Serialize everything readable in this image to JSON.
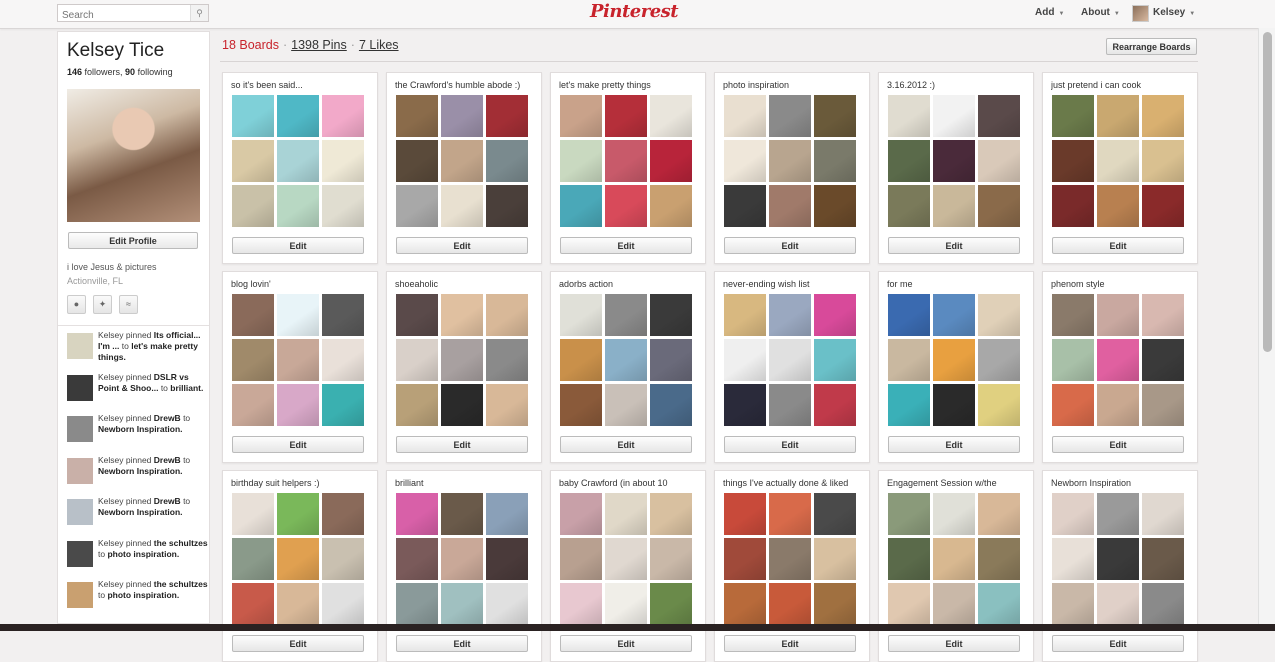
{
  "header": {
    "search_placeholder": "Search",
    "logo": "Pinterest",
    "nav": [
      {
        "label": "Add"
      },
      {
        "label": "About"
      },
      {
        "label": "Kelsey"
      }
    ]
  },
  "profile": {
    "name": "Kelsey Tice",
    "followers": "146",
    "followers_label": " followers, ",
    "following": "90",
    "following_label": " following",
    "edit_label": "Edit Profile",
    "bio": "i love Jesus & pictures",
    "location": "Actionville, FL"
  },
  "activity": [
    {
      "user": "Kelsey",
      "verb": " pinned ",
      "pin": "Its official... I'm ...",
      "to": " to ",
      "board": "let's make pretty things."
    },
    {
      "user": "Kelsey",
      "verb": " pinned ",
      "pin": "DSLR vs Point & Shoo...",
      "to": " to ",
      "board": "brilliant."
    },
    {
      "user": "Kelsey",
      "verb": " pinned ",
      "pin": "DrewB",
      "to": " to ",
      "board": "Newborn Inspiration."
    },
    {
      "user": "Kelsey",
      "verb": " pinned ",
      "pin": "DrewB",
      "to": " to ",
      "board": "Newborn Inspiration."
    },
    {
      "user": "Kelsey",
      "verb": " pinned ",
      "pin": "DrewB",
      "to": " to ",
      "board": "Newborn Inspiration."
    },
    {
      "user": "Kelsey",
      "verb": " pinned ",
      "pin": "the schultzes",
      "to": " to ",
      "board": "photo inspiration."
    },
    {
      "user": "Kelsey",
      "verb": " pinned ",
      "pin": "the schultzes",
      "to": " to ",
      "board": "photo inspiration."
    }
  ],
  "stats": {
    "boards": "18 Boards",
    "pins": "1398 Pins",
    "likes": "7 Likes",
    "separator": "·",
    "rearrange_label": "Rearrange Boards"
  },
  "edit_label": "Edit",
  "boards": [
    {
      "title": "so it's been said...",
      "colors": [
        "#7fd0d8",
        "#4fb8c6",
        "#f2a9c9",
        "#d9c9a5",
        "#a9d3d6",
        "#efe9d6",
        "#c9c1a8",
        "#b8d8c3",
        "#e0ddd0"
      ]
    },
    {
      "title": "the Crawford's humble abode :)",
      "colors": [
        "#8a6b4a",
        "#9a8fa8",
        "#a22e35",
        "#5a4a3a",
        "#c2a58a",
        "#7a8a8e",
        "#a8a8a8",
        "#e8e0d0",
        "#4a3f3a"
      ]
    },
    {
      "title": "let's make pretty things",
      "colors": [
        "#c9a28a",
        "#b52f3a",
        "#e9e5dc",
        "#c9d9c0",
        "#c85a6a",
        "#b8243a",
        "#4aa8b8",
        "#d84a5a",
        "#c9a070"
      ]
    },
    {
      "title": "photo inspiration",
      "colors": [
        "#e9dfd0",
        "#8a8a8a",
        "#6a5a3a",
        "#efe7da",
        "#b8a58f",
        "#7a7a6a",
        "#3a3a3a",
        "#a07a6a",
        "#6a4a2a"
      ]
    },
    {
      "title": "3.16.2012 :)",
      "colors": [
        "#e0dcd0",
        "#f2f2f2",
        "#5a4a4a",
        "#5a6a4a",
        "#4a2a3a",
        "#d9c9b9",
        "#7a7a5a",
        "#c9b89a",
        "#8a6a4a"
      ]
    },
    {
      "title": "just pretend i can cook",
      "colors": [
        "#6a7a4a",
        "#c9a870",
        "#d9b070",
        "#6a3a2a",
        "#e0d8c0",
        "#d9c090",
        "#7a2a2a",
        "#b88050",
        "#8a2a2a"
      ]
    },
    {
      "title": "blog lovin'",
      "colors": [
        "#8a6a5a",
        "#e8f4f8",
        "#5a5a5a",
        "#a08a6a",
        "#c8a898",
        "#e9e0d9",
        "#c9a898",
        "#d8a8c8",
        "#3ab0b0"
      ]
    },
    {
      "title": "shoeaholic",
      "colors": [
        "#5a4a4a",
        "#e0c0a0",
        "#d8b898",
        "#d9d0c9",
        "#a8a0a0",
        "#8a8a8a",
        "#b8a078",
        "#2a2a2a",
        "#d8b898"
      ]
    },
    {
      "title": "adorbs action",
      "colors": [
        "#e0e0d8",
        "#8a8a8a",
        "#3a3a3a",
        "#c9904a",
        "#8ab0c8",
        "#6a6a7a",
        "#8a5a3a",
        "#c9c0b8",
        "#4a6a8a"
      ]
    },
    {
      "title": "never-ending wish list",
      "colors": [
        "#d8b880",
        "#9aa8c0",
        "#d84a9a",
        "#efefef",
        "#e0e0e0",
        "#6ac0c8",
        "#2a2a3a",
        "#8a8a8a",
        "#c03a4a"
      ]
    },
    {
      "title": "for me",
      "colors": [
        "#3a6ab0",
        "#5a8ac0",
        "#e0d0b8",
        "#c9b8a0",
        "#e8a040",
        "#a8a8a8",
        "#3ab0b8",
        "#2a2a2a",
        "#e0d080"
      ]
    },
    {
      "title": "phenom style",
      "colors": [
        "#8a7a6a",
        "#c9a8a0",
        "#d8b8b0",
        "#a8c0a8",
        "#e060a0",
        "#3a3a3a",
        "#d86a4a",
        "#c9a890",
        "#a89888"
      ]
    },
    {
      "title": "birthday suit helpers :)",
      "colors": [
        "#e8e0d8",
        "#7ab85a",
        "#8a6a5a",
        "#8a9a8a",
        "#e0a050",
        "#c9c0b0",
        "#c85a4a",
        "#d8b898",
        "#e0e0e0"
      ]
    },
    {
      "title": "brilliant",
      "colors": [
        "#d860a8",
        "#6a5a4a",
        "#8aa0b8",
        "#7a5a5a",
        "#c9a898",
        "#4a3a3a",
        "#8a9a9a",
        "#a0c0c0",
        "#e0e0e0"
      ]
    },
    {
      "title": "baby Crawford (in about 10",
      "colors": [
        "#c8a0a8",
        "#e0d8c8",
        "#d8c0a0",
        "#b8a090",
        "#e0d8d0",
        "#c9b8a8",
        "#e8c8d0",
        "#f0eee8",
        "#6a8a4a"
      ]
    },
    {
      "title": "things I've actually done & liked",
      "colors": [
        "#c84a3a",
        "#d86a4a",
        "#4a4a4a",
        "#a04a3a",
        "#8a7a6a",
        "#d8c0a0",
        "#b86a3a",
        "#c85a3a",
        "#a07040"
      ]
    },
    {
      "title": "Engagement Session w/the",
      "colors": [
        "#8a9a7a",
        "#e0e0d8",
        "#d8b898",
        "#5a6a4a",
        "#d8b890",
        "#8a7a5a",
        "#e0c8b0",
        "#c9b8a8",
        "#8ac0c0"
      ]
    },
    {
      "title": "Newborn Inspiration",
      "colors": [
        "#e0d0c8",
        "#9a9a9a",
        "#e0d8d0",
        "#e8e0d8",
        "#3a3a3a",
        "#6a5a4a",
        "#c9b8a8",
        "#e0d0c8",
        "#8a8a8a"
      ]
    }
  ]
}
